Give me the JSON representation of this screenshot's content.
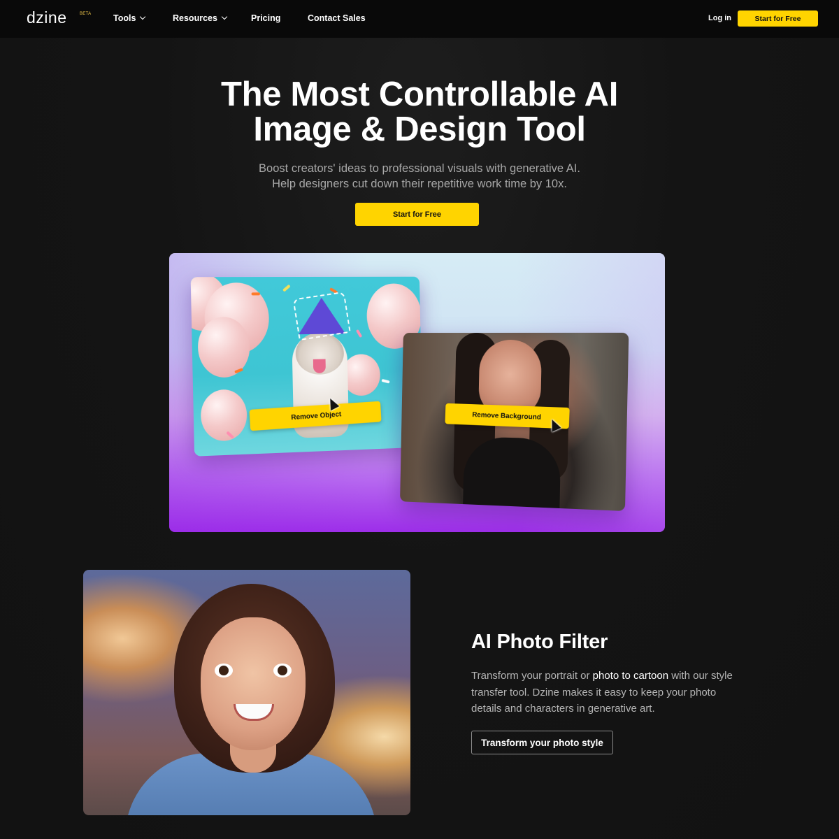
{
  "nav": {
    "logo": "dzine",
    "beta": "BETA",
    "items": [
      {
        "label": "Tools",
        "has_dropdown": true
      },
      {
        "label": "Resources",
        "has_dropdown": true
      },
      {
        "label": "Pricing",
        "has_dropdown": false
      },
      {
        "label": "Contact Sales",
        "has_dropdown": false
      }
    ],
    "login": "Log in",
    "cta": "Start for Free"
  },
  "hero": {
    "title_line1": "The Most Controllable AI",
    "title_line2": "Image & Design Tool",
    "subtitle_line1": "Boost creators' ideas to professional visuals with generative AI.",
    "subtitle_line2": "Help designers cut down their repetitive work time by 10x.",
    "cta": "Start for Free"
  },
  "showcase": {
    "card1_action": "Remove Object",
    "card2_action": "Remove Background"
  },
  "feature": {
    "title": "AI Photo Filter",
    "desc_before": "Transform your portrait or ",
    "desc_highlight": "photo to cartoon",
    "desc_after": " with our style transfer tool. Dzine makes it easy to keep your photo details and characters in generative art.",
    "button": "Transform your photo style"
  },
  "colors": {
    "background": "#121212",
    "accent": "#ffd400",
    "text_muted": "#a8a8a8"
  }
}
